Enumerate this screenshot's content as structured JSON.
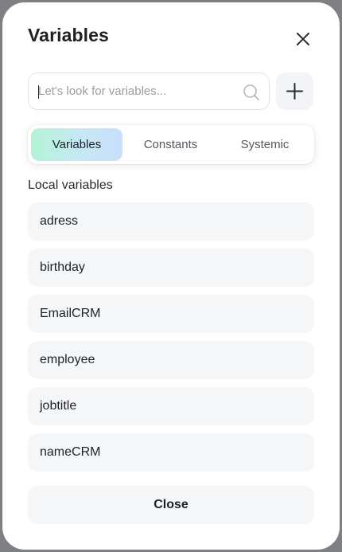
{
  "dialog": {
    "title": "Variables",
    "close_icon": "close-icon"
  },
  "search": {
    "placeholder": "Let's look for variables...",
    "value": "",
    "icon": "search-icon"
  },
  "add_button": {
    "icon": "plus-icon"
  },
  "tabs": [
    {
      "label": "Variables",
      "active": true
    },
    {
      "label": "Constants",
      "active": false
    },
    {
      "label": "Systemic",
      "active": false
    }
  ],
  "section": {
    "label": "Local variables"
  },
  "variables": [
    {
      "name": "adress"
    },
    {
      "name": "birthday"
    },
    {
      "name": "EmailCRM"
    },
    {
      "name": "employee"
    },
    {
      "name": "jobtitle"
    },
    {
      "name": "nameCRM"
    }
  ],
  "footer": {
    "close_label": "Close"
  },
  "colors": {
    "accent_gradient_start": "#b3f3d6",
    "accent_gradient_end": "#c8defa",
    "item_background": "#f5f6f8"
  }
}
